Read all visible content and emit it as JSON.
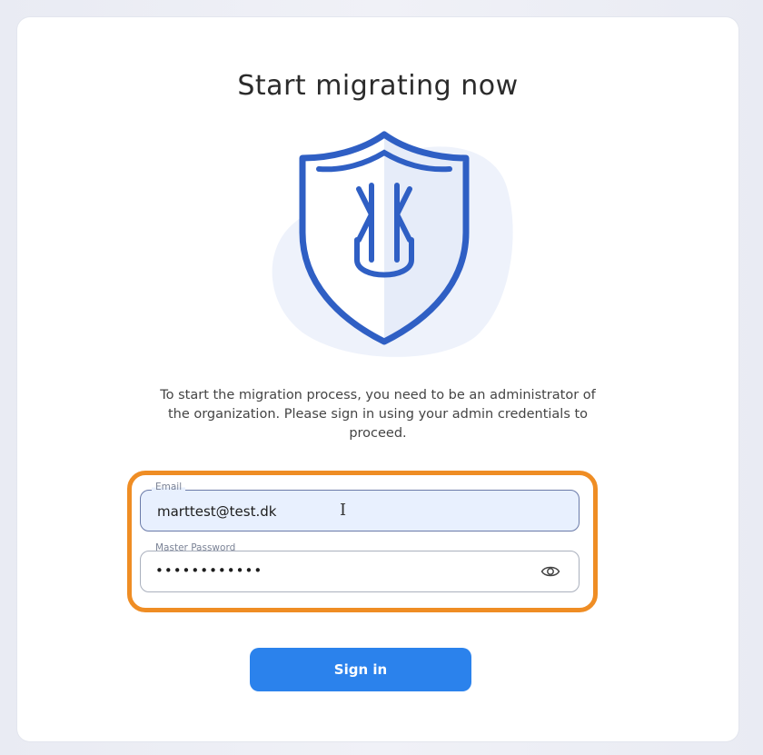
{
  "page": {
    "title": "Start migrating now",
    "description": "To start the migration process, you need to be an administrator of the organization. Please sign in using your admin credentials to proceed."
  },
  "form": {
    "email_label": "Email",
    "email_value": "marttest@test.dk",
    "password_label": "Master Password",
    "password_value": "••••••••••••",
    "show_password_icon": "eye-icon",
    "submit_label": "Sign in"
  },
  "illustration": {
    "icon": "shield-logo-icon"
  },
  "colors": {
    "accent": "#2b82ec",
    "highlight": "#ef8d24",
    "shield_stroke": "#2f5fc4"
  }
}
